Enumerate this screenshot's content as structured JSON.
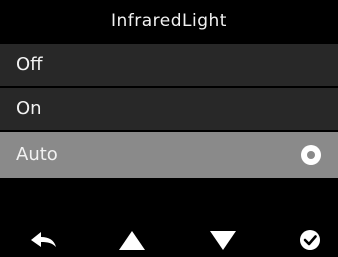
{
  "title": "InfraredLight",
  "menu": {
    "items": [
      {
        "label": "Off",
        "selected": false
      },
      {
        "label": "On",
        "selected": false
      },
      {
        "label": "Auto",
        "selected": true
      }
    ]
  },
  "softkeys": [
    {
      "icon": "back-arrow-icon"
    },
    {
      "icon": "up-triangle-icon"
    },
    {
      "icon": "down-triangle-icon"
    },
    {
      "icon": "checkmark-circle-icon"
    }
  ],
  "colors": {
    "background": "#000000",
    "item_background": "#282828",
    "selected_background": "#8a8a8a",
    "text": "#f2f2f2"
  }
}
